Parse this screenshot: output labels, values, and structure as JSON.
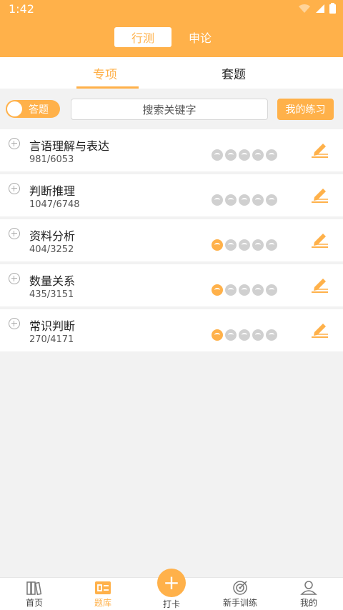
{
  "status_bar": {
    "time": "1:42"
  },
  "header": {
    "tabs": [
      {
        "label": "行测",
        "active": true
      },
      {
        "label": "申论",
        "active": false
      }
    ]
  },
  "subtabs": [
    {
      "label": "专项",
      "active": true
    },
    {
      "label": "套题",
      "active": false
    }
  ],
  "toolbar": {
    "toggle_label": "答题",
    "search_placeholder": "搜索关键字",
    "practice_button": "我的练习"
  },
  "categories": [
    {
      "title": "言语理解与表达",
      "progress": "981/6053",
      "stars_filled": 0
    },
    {
      "title": "判断推理",
      "progress": "1047/6748",
      "stars_filled": 0
    },
    {
      "title": "资料分析",
      "progress": "404/3252",
      "stars_filled": 1
    },
    {
      "title": "数量关系",
      "progress": "435/3151",
      "stars_filled": 1
    },
    {
      "title": "常识判断",
      "progress": "270/4171",
      "stars_filled": 1
    }
  ],
  "stars_total": 5,
  "bottom_nav": [
    {
      "label": "首页",
      "icon": "books-icon",
      "active": false
    },
    {
      "label": "题库",
      "icon": "question-bank-icon",
      "active": true
    },
    {
      "label": "打卡",
      "icon": "plus-icon",
      "active": false
    },
    {
      "label": "新手训练",
      "icon": "target-icon",
      "active": false
    },
    {
      "label": "我的",
      "icon": "user-icon",
      "active": false
    }
  ],
  "colors": {
    "accent": "#ffb14a",
    "background": "#f2f2f2",
    "star_empty": "#d0d0d0"
  }
}
